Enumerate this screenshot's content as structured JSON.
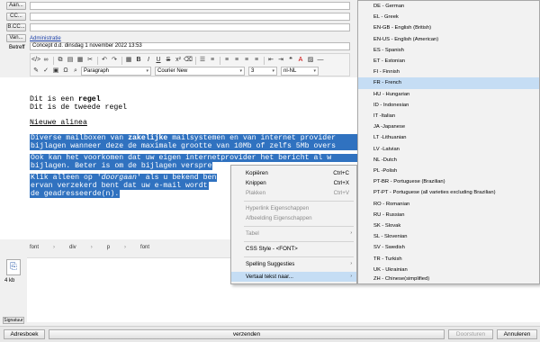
{
  "header": {
    "to_label": "Aan...",
    "cc_label": "CC...",
    "bcc_label": "B.CC...",
    "from_label": "Van...",
    "from_value": "Administratie",
    "subject_label": "Betreff",
    "subject_value": "Concept d.d. dinsdag 1 november 2022 13:53"
  },
  "toolbar": {
    "paragraph_style": "Paragraph",
    "font_name": "Courier New",
    "font_size": "3",
    "language": "nl-NL"
  },
  "document": {
    "line1_pre": "Dit is een ",
    "line1_bold": "regel",
    "line2": "Dit is de tweede regel",
    "heading": "Nieuwe alinea",
    "p1_line1_pre": "Diverse mailboxen van ",
    "p1_line1_bold": "zakelijke",
    "p1_line1_post": " mailsystemen en van internet provider",
    "p1_line2": "bijlagen wanneer deze de maximale grootte van 10Mb of zelfs 5Mb overs",
    "p2_line1": "Ook kan het voorkomen dat uw eigen internetprovider het bericht al w",
    "p2_line2": "bijlagen. Beter is om de bijlagen verspre",
    "p3_line1_pre": "Klik alleen op '",
    "p3_line1_italic": "doorgaan",
    "p3_line1_post": "' als u bekend ben",
    "p3_line2": "ervan verzekerd bent dat uw e-mail wordt",
    "p3_line3": "de geadresseerde(n)."
  },
  "breadcrumb": [
    "font",
    "div",
    "p",
    "font"
  ],
  "attachment": {
    "size": "4 kb",
    "signature_button": "Signatuur"
  },
  "bottom_bar": {
    "address_book": "Adresboek",
    "send": "verzenden",
    "forward": "Doorsturen",
    "cancel": "Annuleren"
  },
  "context_menu": [
    {
      "label": "Kopiëren",
      "shortcut": "Ctrl+C",
      "disabled": false
    },
    {
      "label": "Knippen",
      "shortcut": "Ctrl+X",
      "disabled": false
    },
    {
      "label": "Plakken",
      "shortcut": "Ctrl+V",
      "disabled": true
    },
    {
      "label": "Hyperlink Eigenschappen",
      "shortcut": "",
      "disabled": true
    },
    {
      "label": "Afbeelding Eigenschappen",
      "shortcut": "",
      "disabled": true
    },
    {
      "label": "Tabel",
      "shortcut": "",
      "disabled": true
    },
    {
      "label": "CSS Style - <FONT>",
      "shortcut": "",
      "disabled": false
    },
    {
      "label": "Spelling Suggesties",
      "shortcut": "",
      "disabled": false
    },
    {
      "label": "Vertaal tekst naar...",
      "shortcut": "",
      "disabled": false
    }
  ],
  "languages": [
    "DE - German",
    "EL - Greek",
    "EN-GB - English (British)",
    "EN-US - English (American)",
    "ES - Spanish",
    "ET - Estonian",
    "FI - Finnish",
    "FR - French",
    "HU - Hungarian",
    "ID - Indonesian",
    "IT -Italian",
    "JA -Japanese",
    "LT -Lithuanian",
    "LV -Latvian",
    "NL -Dutch",
    "PL -Polish",
    "PT-BR - Portuguese (Brazilian)",
    "PT-PT - Portuguese (all varieties excluding Brazilian)",
    "RO - Romanian",
    "RU - Russian",
    "SK - Slovak",
    "SL - Slovenian",
    "SV - Swedish",
    "TR - Turkish",
    "UK - Ukrainian",
    "ZH - Chinese(simplified)"
  ],
  "selected_language_index": 7,
  "colors": {
    "selection": "#3072c0",
    "menu_highlight": "#c5ddf4",
    "link": "#1a3fa8"
  },
  "icons": {
    "attachment": "paperclip-icon",
    "submenu": "chevron-right-icon"
  }
}
